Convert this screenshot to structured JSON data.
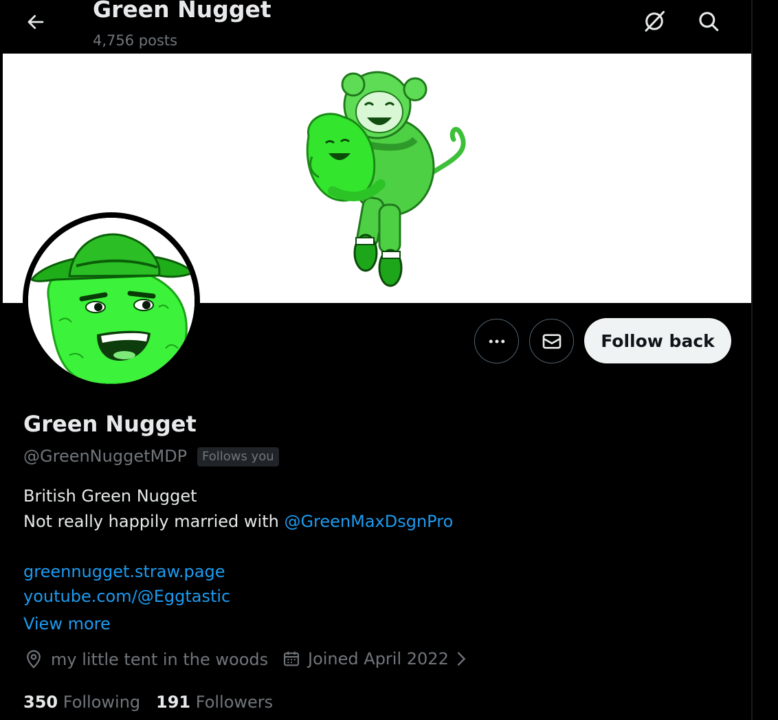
{
  "header": {
    "title": "Green Nugget",
    "post_count": "4,756 posts"
  },
  "actions": {
    "follow_label": "Follow back"
  },
  "profile": {
    "name": "Green Nugget",
    "handle": "@GreenNuggetMDP",
    "follows_badge": "Follows you",
    "bio_line1": "British Green Nugget",
    "bio_line2_prefix": "Not really happily married with ",
    "bio_mention": "@GreenMaxDsgnPro",
    "links": [
      "greennugget.straw.page",
      "youtube.com/@Eggtastic"
    ],
    "view_more": "View more",
    "location": "my little tent in the woods",
    "joined": "Joined April 2022",
    "following_count": "350",
    "following_label": "Following",
    "followers_count": "191",
    "followers_label": "Followers"
  },
  "icons": {
    "back": "arrow-left-icon",
    "grok": "slashed-circle-icon",
    "search": "search-icon",
    "more": "more-dots-icon",
    "message": "envelope-icon",
    "location": "location-pin-icon",
    "calendar": "calendar-icon",
    "chevron": "chevron-right-icon"
  },
  "colors": {
    "background": "#000000",
    "text_primary": "#e7e9ea",
    "text_secondary": "#71767b",
    "link": "#1d9bf0",
    "follow_button": "#eff3f4",
    "mascot_green": "#33e62d"
  }
}
